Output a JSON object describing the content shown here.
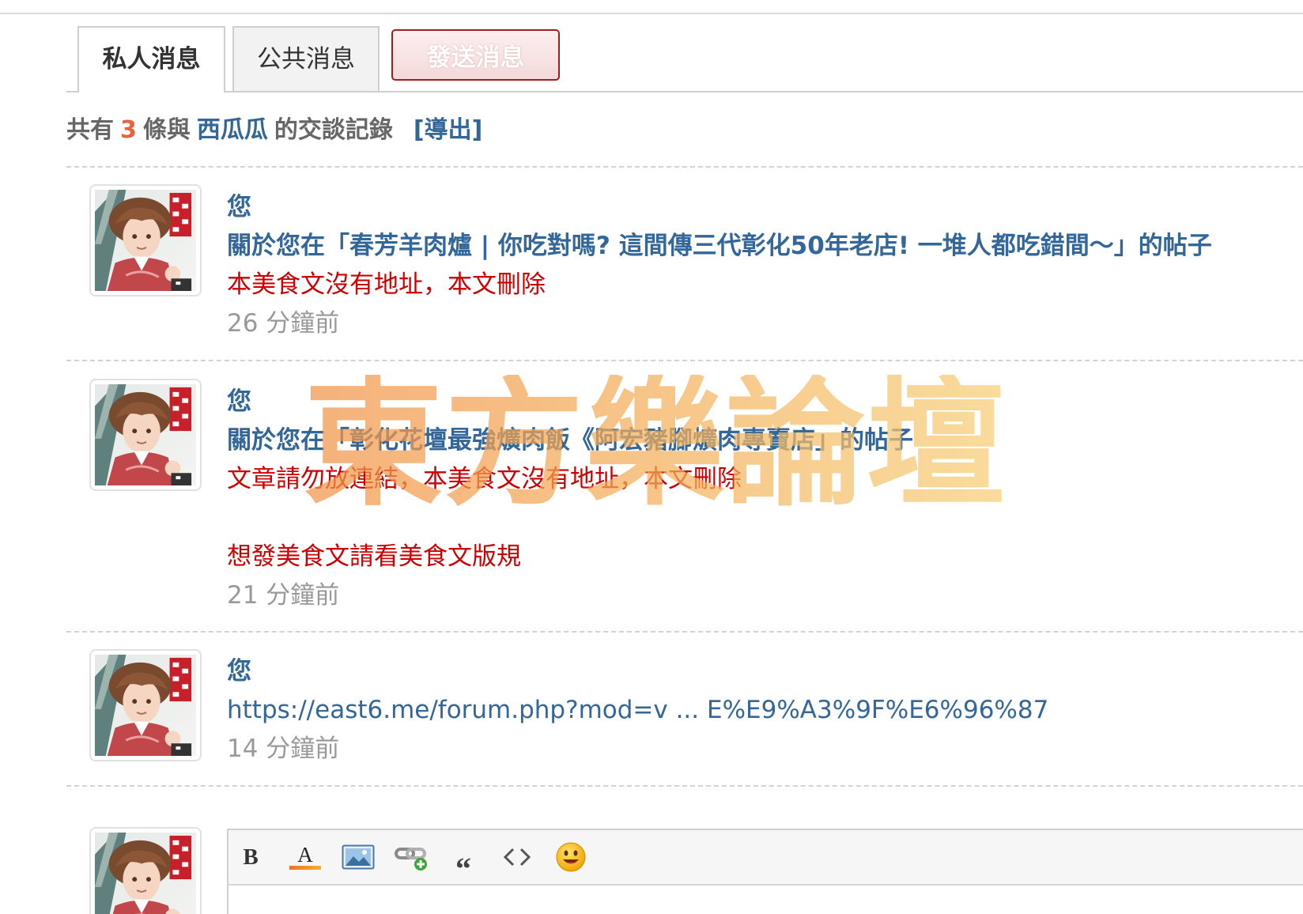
{
  "tabs": {
    "private": "私人消息",
    "public": "公共消息",
    "send": "發送消息"
  },
  "summary": {
    "prefix": "共有",
    "count": "3",
    "mid": "條與",
    "user": "西瓜瓜",
    "suffix": "的交談記錄",
    "export": "[導出]"
  },
  "messages": [
    {
      "author": "您",
      "title": "關於您在「春芳羊肉爐 | 你吃對嗎? 這間傳三代彰化50年老店! 一堆人都吃錯間～」的帖子",
      "body": [
        "本美食文沒有地址，本文刪除"
      ],
      "time": "26 分鐘前"
    },
    {
      "author": "您",
      "title": "關於您在「彰化花壇最強爌肉飯《阿宏豬腳爌肉專賣店」的帖子",
      "body": [
        "文章請勿放連結，本美食文沒有地址，本文刪除",
        "",
        "想發美食文請看美食文版規"
      ],
      "time": "21 分鐘前"
    },
    {
      "author": "您",
      "link": "https://east6.me/forum.php?mod=v ... E%E9%A3%9F%E6%96%87",
      "time": "14 分鐘前"
    }
  ],
  "editor": {
    "toolbar": [
      {
        "icon": "bold-icon",
        "glyph": "B"
      },
      {
        "icon": "font-color-icon",
        "glyph": "A"
      },
      {
        "icon": "image-icon"
      },
      {
        "icon": "link-icon"
      },
      {
        "icon": "quote-icon",
        "glyph": "“"
      },
      {
        "icon": "code-icon"
      },
      {
        "icon": "smiley-icon"
      }
    ]
  },
  "watermark": "東方樂論壇",
  "colors": {
    "link_blue": "#336699",
    "alert_red": "#cc0000",
    "count_orange": "#e8623d",
    "muted_gray": "#999999",
    "send_button_border": "#9e1f1f"
  }
}
